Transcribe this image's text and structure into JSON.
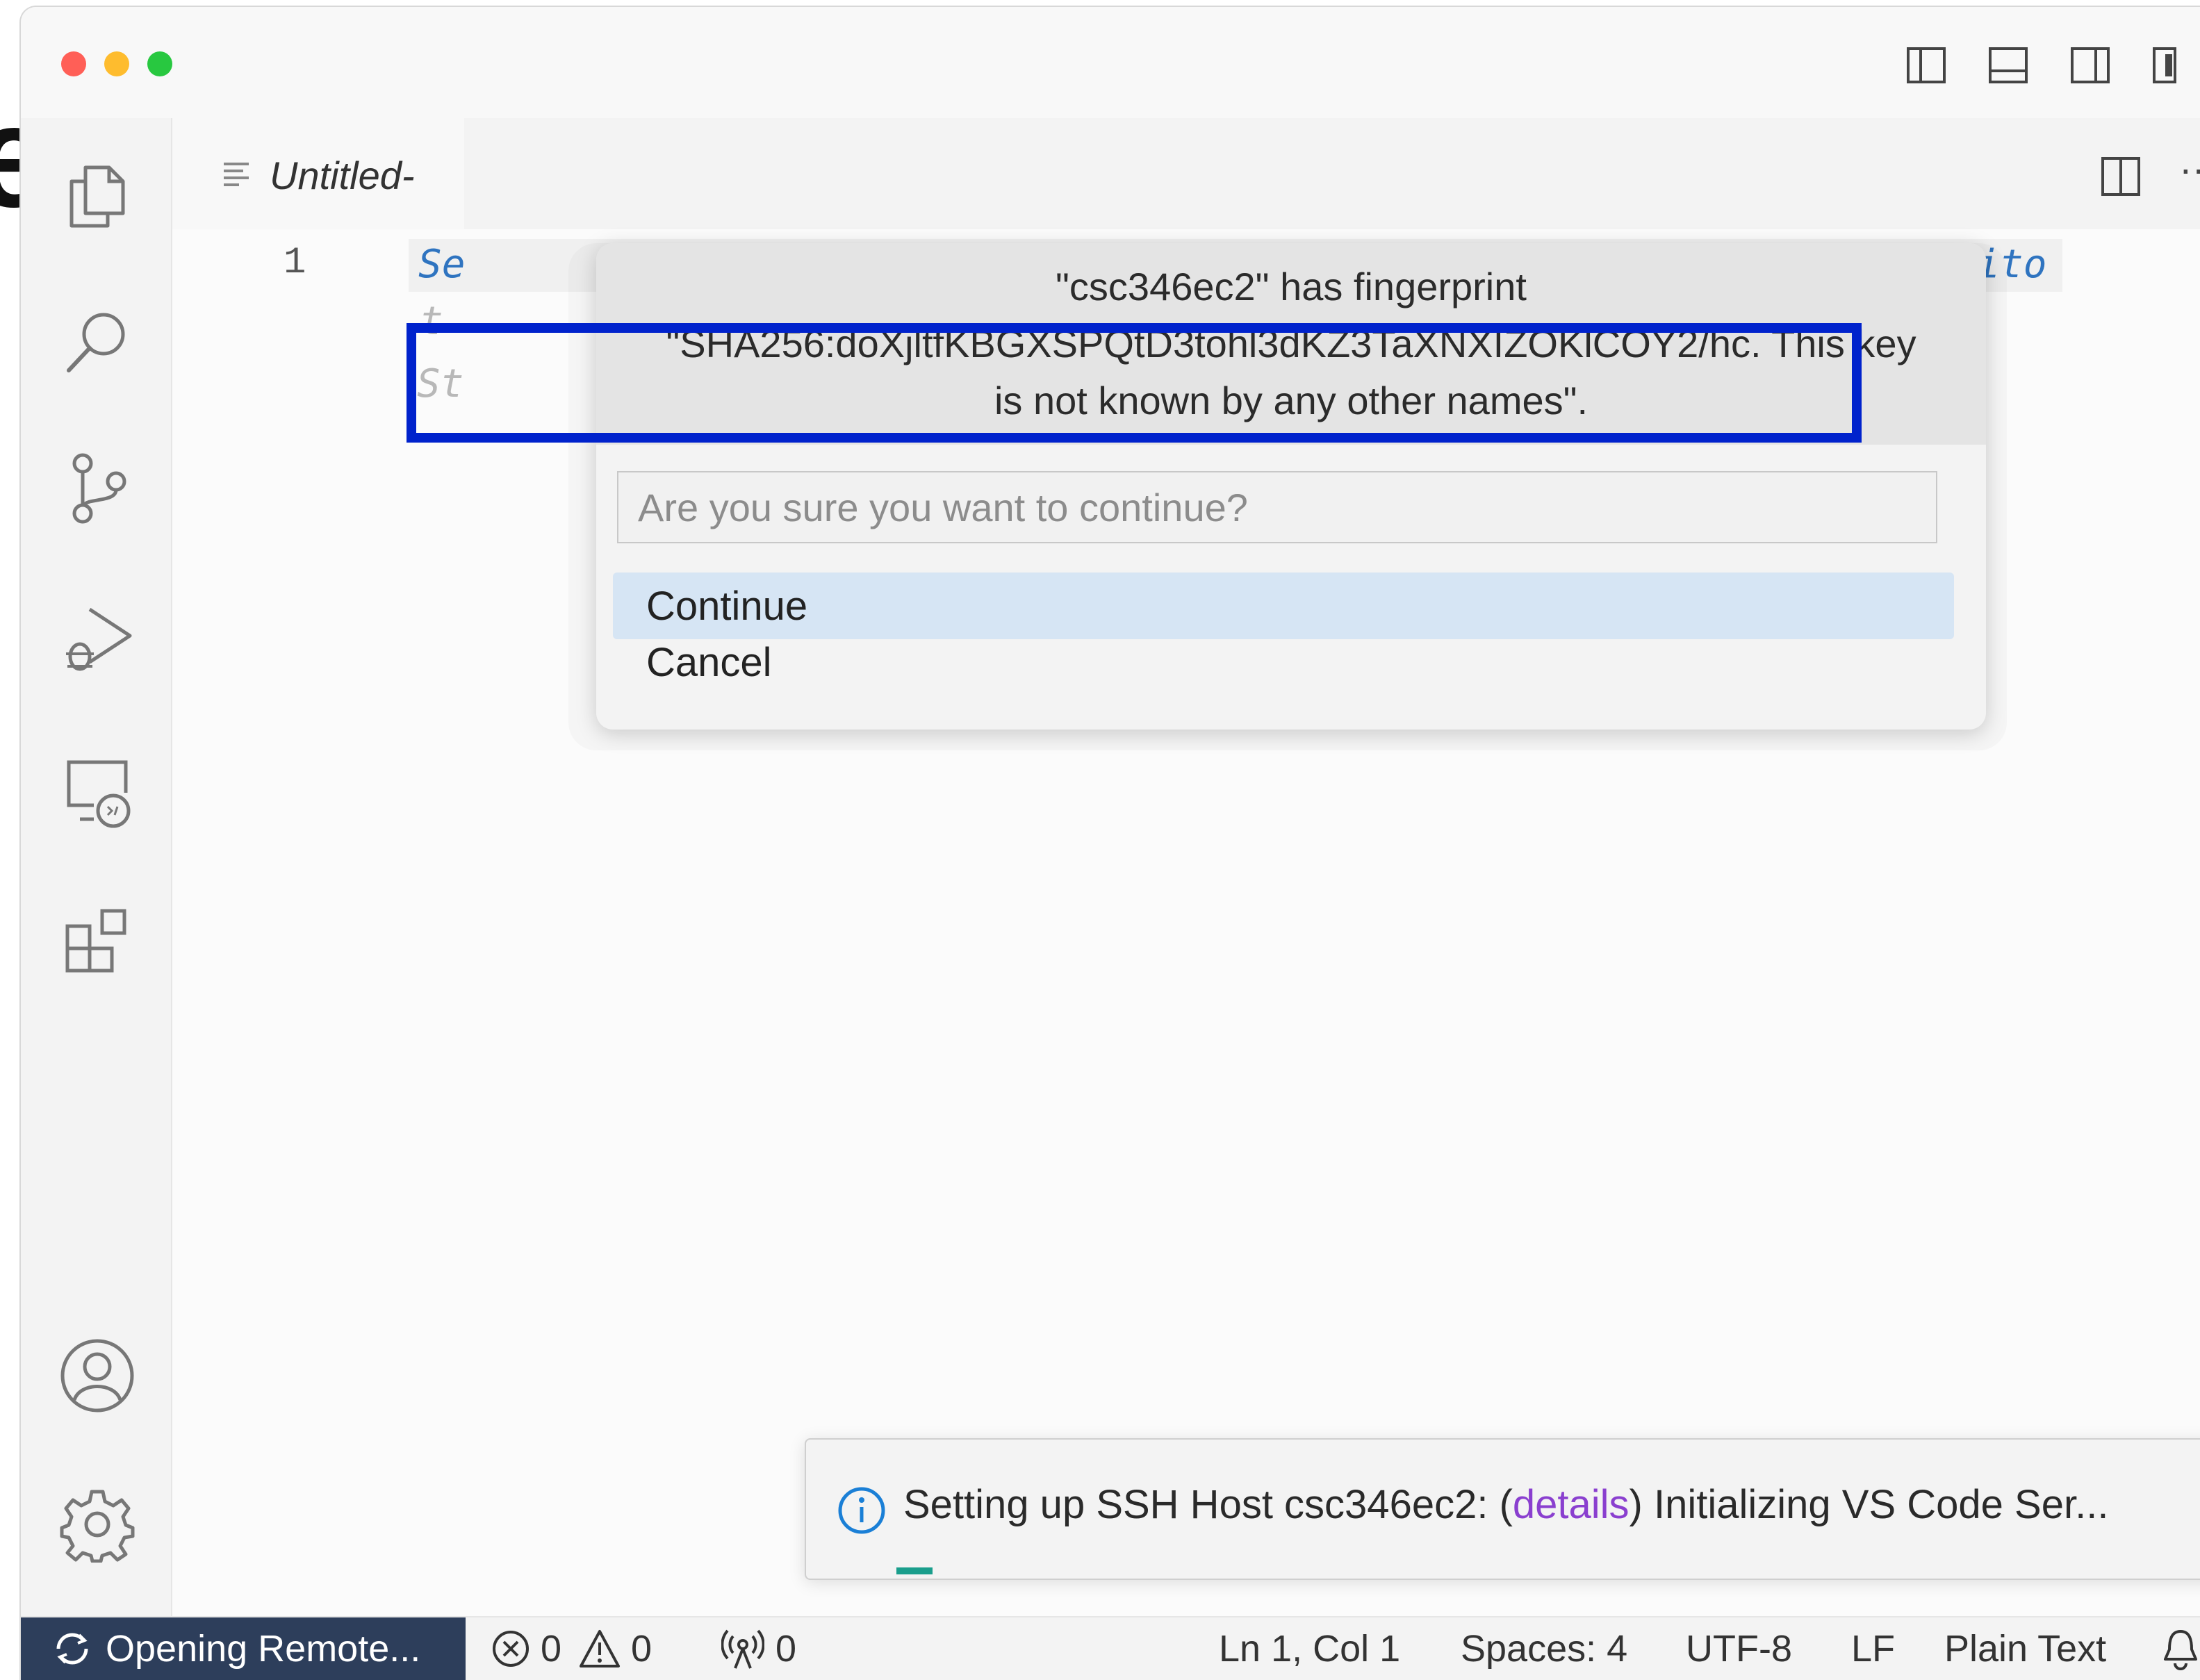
{
  "tab": {
    "label": "Untitled-"
  },
  "editor": {
    "line_number": "1",
    "code_left": "Se",
    "code_right": "ent edito",
    "code_gray_1": "t",
    "code_gray_2": "St"
  },
  "dialog": {
    "message_line1": "\"csc346ec2\" has fingerprint",
    "message_line2": "\"SHA256:doXjltfKBGXSPQtD3tohl3dKZ3TaXNXIZOKlCOY2/hc. This key",
    "message_line3": "is not known by any other names\".",
    "input_placeholder": "Are you sure you want to continue?",
    "options": [
      {
        "label": "Continue"
      },
      {
        "label": "Cancel"
      }
    ]
  },
  "notification": {
    "prefix": "Setting up SSH Host csc346ec2: (",
    "link": "details",
    "suffix": ") Initializing VS Code Ser..."
  },
  "statusbar": {
    "remote": "Opening Remote...",
    "errors": "0",
    "warnings": "0",
    "ports": "0",
    "position": "Ln 1, Col 1",
    "spaces": "Spaces: 4",
    "encoding": "UTF-8",
    "eol": "LF",
    "language": "Plain Text"
  },
  "icons": {
    "activity": [
      "files-icon",
      "search-icon",
      "source-control-icon",
      "run-debug-icon",
      "remote-explorer-icon",
      "extensions-icon",
      "account-icon",
      "gear-icon"
    ]
  },
  "colors": {
    "highlight": "#0022cc",
    "selection": "#d6e5f4",
    "remote_bg": "#2d3e5b",
    "link": "#8a3fcf"
  }
}
